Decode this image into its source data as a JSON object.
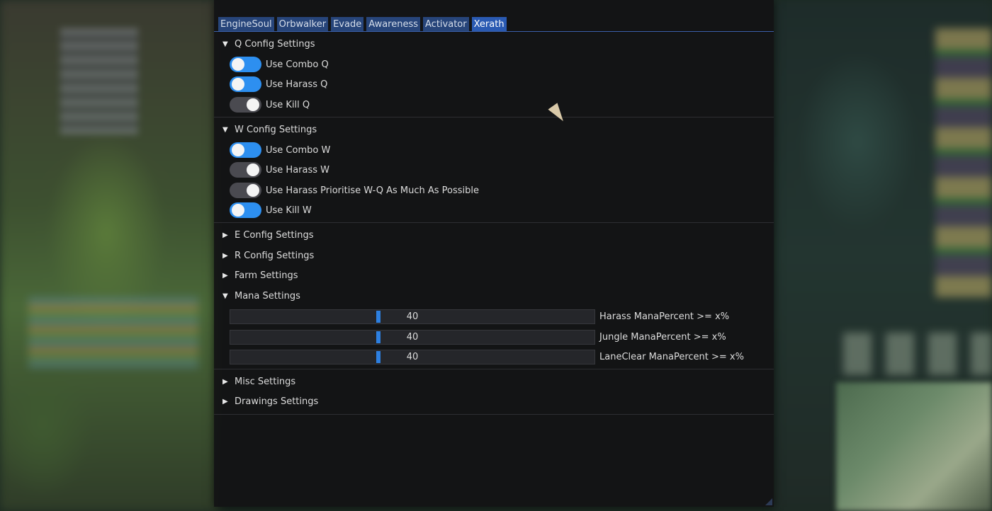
{
  "tabs": [
    {
      "label": "EngineSoul",
      "active": false
    },
    {
      "label": "Orbwalker",
      "active": false
    },
    {
      "label": "Evade",
      "active": false
    },
    {
      "label": "Awareness",
      "active": false
    },
    {
      "label": "Activator",
      "active": false
    },
    {
      "label": "Xerath",
      "active": true
    }
  ],
  "sections": {
    "q": {
      "title": "Q Config Settings",
      "expanded": true,
      "toggles": [
        {
          "label": "Use Combo Q",
          "on": true
        },
        {
          "label": "Use Harass Q",
          "on": true
        },
        {
          "label": "Use Kill Q",
          "on": false
        }
      ]
    },
    "w": {
      "title": "W Config Settings",
      "expanded": true,
      "toggles": [
        {
          "label": "Use Combo W",
          "on": true
        },
        {
          "label": "Use Harass W",
          "on": false
        },
        {
          "label": "Use Harass Prioritise W-Q As Much As Possible",
          "on": false
        },
        {
          "label": "Use Kill W",
          "on": true
        }
      ]
    },
    "e": {
      "title": "E Config Settings",
      "expanded": false
    },
    "r": {
      "title": "R Config Settings",
      "expanded": false
    },
    "farm": {
      "title": "Farm Settings",
      "expanded": false
    },
    "mana": {
      "title": "Mana Settings",
      "expanded": true,
      "sliders": [
        {
          "label": "Harass ManaPercent >= x%",
          "value": "40",
          "percent": 40
        },
        {
          "label": "Jungle ManaPercent >= x%",
          "value": "40",
          "percent": 40
        },
        {
          "label": "LaneClear ManaPercent >= x%",
          "value": "40",
          "percent": 40
        }
      ]
    },
    "misc": {
      "title": "Misc Settings",
      "expanded": false
    },
    "drawings": {
      "title": "Drawings Settings",
      "expanded": false
    }
  },
  "icons": {
    "expanded_arrow": "▼",
    "collapsed_arrow": "▶"
  },
  "colors": {
    "toggle_on": "#2d8ff0",
    "toggle_off": "#4a4a50",
    "tab_active": "#2a5ab2",
    "tab_inactive": "#27457a"
  }
}
